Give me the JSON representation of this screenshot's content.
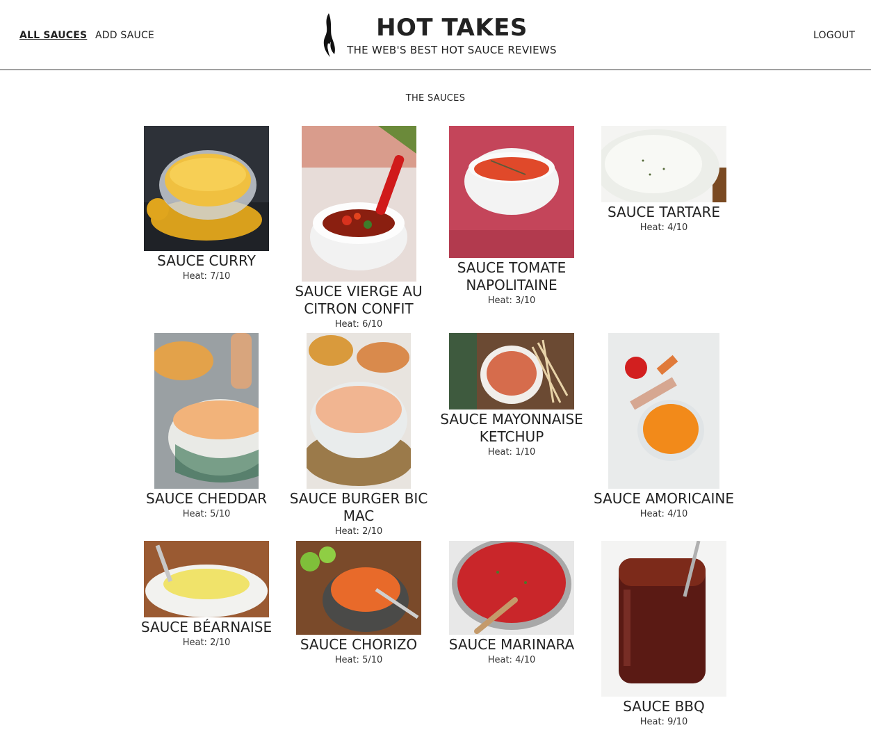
{
  "nav": {
    "all_sauces": "ALL SAUCES",
    "add_sauce": "ADD SAUCE",
    "logout": "LOGOUT"
  },
  "brand": {
    "title": "HOT TAKES",
    "subtitle": "THE WEB'S BEST HOT SAUCE REVIEWS"
  },
  "section_title": "THE SAUCES",
  "sauces": [
    {
      "name": "SAUCE CURRY",
      "heat": "Heat: 7/10",
      "image": "curry-sauce-photo"
    },
    {
      "name": "SAUCE VIERGE AU CITRON CONFIT",
      "heat": "Heat: 6/10",
      "image": "sauce-vierge-photo"
    },
    {
      "name": "SAUCE TOMATE NAPOLITAINE",
      "heat": "Heat: 3/10",
      "image": "tomato-sauce-photo"
    },
    {
      "name": "SAUCE TARTARE",
      "heat": "Heat: 4/10",
      "image": "tartare-sauce-photo"
    },
    {
      "name": "SAUCE CHEDDAR",
      "heat": "Heat: 5/10",
      "image": "cheddar-sauce-photo"
    },
    {
      "name": "SAUCE BURGER BIC MAC",
      "heat": "Heat: 2/10",
      "image": "burger-sauce-photo"
    },
    {
      "name": "SAUCE MAYONNAISE KETCHUP",
      "heat": "Heat: 1/10",
      "image": "mayo-ketchup-photo"
    },
    {
      "name": "SAUCE AMORICAINE",
      "heat": "Heat: 4/10",
      "image": "americaine-sauce-photo"
    },
    {
      "name": "SAUCE BÉARNAISE",
      "heat": "Heat: 2/10",
      "image": "bearnaise-sauce-photo"
    },
    {
      "name": "SAUCE CHORIZO",
      "heat": "Heat: 5/10",
      "image": "chorizo-sauce-photo"
    },
    {
      "name": "SAUCE MARINARA",
      "heat": "Heat: 4/10",
      "image": "marinara-sauce-photo"
    },
    {
      "name": "SAUCE BBQ",
      "heat": "Heat: 9/10",
      "image": "bbq-sauce-photo"
    }
  ],
  "colors": {
    "text": "#222222",
    "header_border": "#333333"
  }
}
